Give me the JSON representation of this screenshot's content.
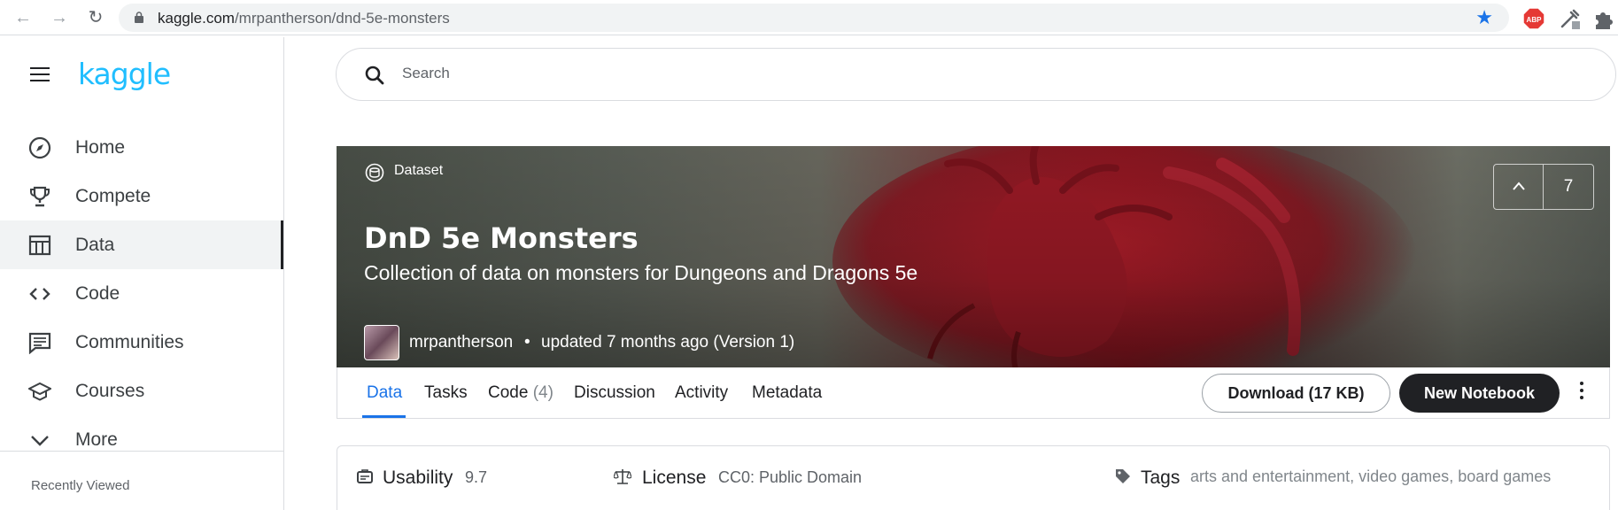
{
  "browser": {
    "url_domain": "kaggle.com",
    "url_path": "/mrpantherson/dnd-5e-monsters",
    "extension_abp": "ABP"
  },
  "sidebar": {
    "logo": "kaggle",
    "items": [
      {
        "label": "Home",
        "icon": "compass-icon"
      },
      {
        "label": "Compete",
        "icon": "trophy-icon"
      },
      {
        "label": "Data",
        "icon": "table-icon"
      },
      {
        "label": "Code",
        "icon": "code-icon"
      },
      {
        "label": "Communities",
        "icon": "chat-icon"
      },
      {
        "label": "Courses",
        "icon": "graduation-cap-icon"
      },
      {
        "label": "More",
        "icon": "chevron-down-icon"
      }
    ],
    "active_item": "Data",
    "recently_viewed": "Recently Viewed"
  },
  "search": {
    "placeholder": "Search"
  },
  "dataset": {
    "type_label": "Dataset",
    "title": "DnD 5e Monsters",
    "subtitle": "Collection of data on monsters for Dungeons and Dragons 5e",
    "author": "mrpantherson",
    "separator": "•",
    "updated": "updated 7 months ago (Version 1)",
    "votes": "7"
  },
  "tabs": [
    {
      "label": "Data",
      "count": ""
    },
    {
      "label": "Tasks",
      "count": ""
    },
    {
      "label": "Code",
      "count": "(4)"
    },
    {
      "label": "Discussion",
      "count": ""
    },
    {
      "label": "Activity",
      "count": ""
    },
    {
      "label": "Metadata",
      "count": ""
    }
  ],
  "actions": {
    "download": "Download (17 KB)",
    "new_notebook": "New Notebook"
  },
  "info": {
    "usability_label": "Usability",
    "usability_value": "9.7",
    "license_label": "License",
    "license_value": "CC0: Public Domain",
    "tags_label": "Tags",
    "tags": [
      "arts and entertainment",
      "video games",
      "board games"
    ]
  },
  "colors": {
    "accent": "#20beff",
    "active_tab": "#1a73e8",
    "primary_button": "#202124"
  }
}
